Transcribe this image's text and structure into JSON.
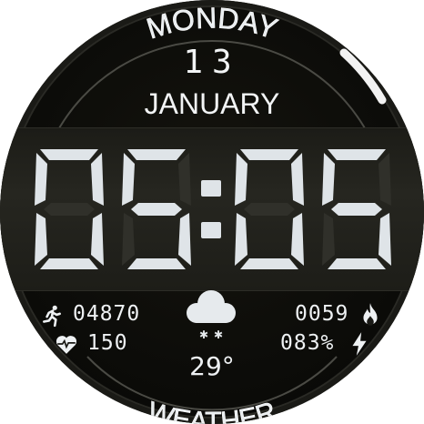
{
  "watch": {
    "day_name": "MONDAY",
    "day_number": "13",
    "month": "JANUARY",
    "hours": "05",
    "minutes": "05",
    "separator": ":",
    "footer_label": "WEATHER"
  },
  "stats": {
    "steps": "04870",
    "heart_rate": "150",
    "calories": "0059",
    "battery": "083%"
  },
  "weather": {
    "temperature": "29°",
    "condition_icon": "snow-cloud-icon"
  },
  "icons": {
    "steps": "running-person-icon",
    "heart": "heart-pulse-icon",
    "calories": "flame-icon",
    "battery": "lightning-bolt-icon"
  },
  "colors": {
    "text": "#eef1f3",
    "digit_on": "#dfe4e8",
    "digit_off": "#30302a",
    "bezel": "#050505"
  }
}
